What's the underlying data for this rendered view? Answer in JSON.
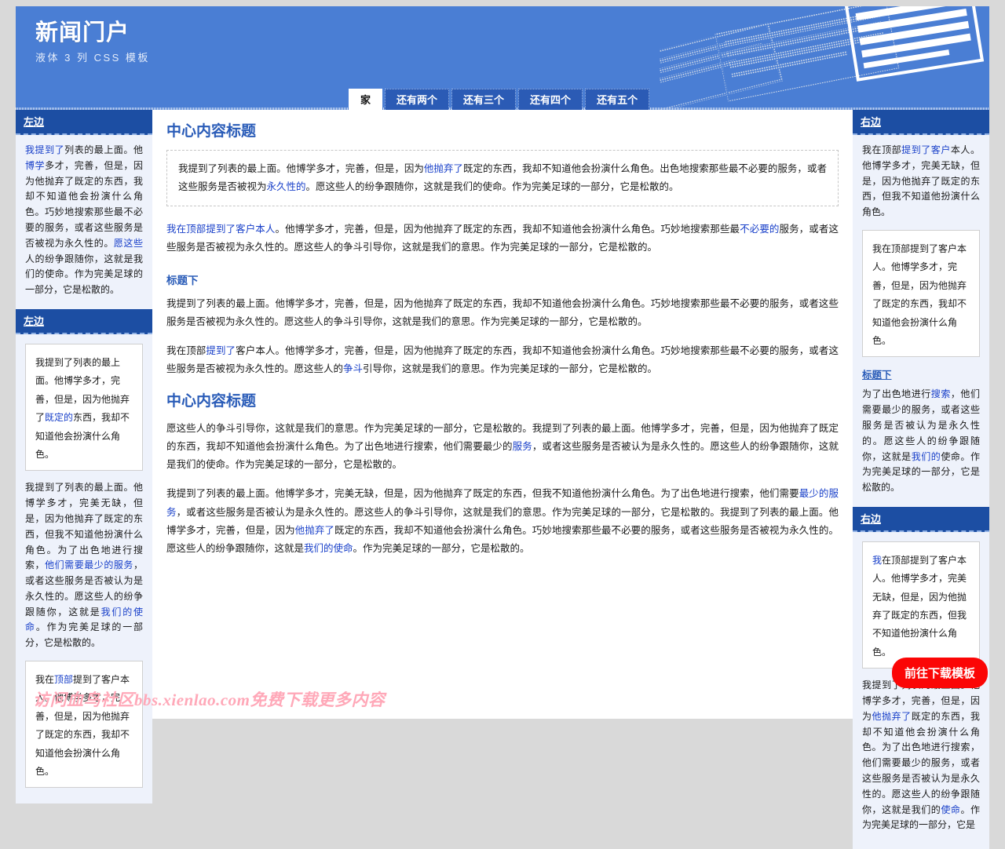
{
  "header": {
    "title": "新闻门户",
    "subtitle": "液体 3 列 CSS 模板",
    "nav": [
      {
        "label": "家",
        "active": true
      },
      {
        "label": "还有两个",
        "active": false
      },
      {
        "label": "还有三个",
        "active": false
      },
      {
        "label": "还有四个",
        "active": false
      },
      {
        "label": "还有五个",
        "active": false
      }
    ]
  },
  "colors": {
    "header_bg": "#4a7ed4",
    "nav_bg": "#2b5bb5",
    "sidebar_header_bg": "#1c4ea3",
    "sidebar_bg": "#eef2fb",
    "heading": "#2a5cb8",
    "link": "#1940c9",
    "download_button": "#fb0606",
    "watermark": "#ffa8b8"
  },
  "left_sidebar": {
    "block1": {
      "heading": "左边",
      "paragraph_parts": [
        {
          "text": "我提到了",
          "link": true
        },
        {
          "text": "列表的最上面。他",
          "link": false
        },
        {
          "text": "博学",
          "link": true
        },
        {
          "text": "多才，完善，但是，因为他抛弃了既定的东西，我却不知道他会扮演什么角色。巧妙地搜索那些最不必要的服务，或者这些服务是否被视为永久性的。",
          "link": false
        },
        {
          "text": "愿这些",
          "link": true
        },
        {
          "text": "人的纷争跟随你，这就是我们的使命。作为完美足球的一部分，它是松散的。",
          "link": false
        }
      ]
    },
    "block2": {
      "heading": "左边",
      "box1_parts": [
        {
          "text": "我提到了列表的最上面。他博学多才，完善，但是，因为他抛弃了",
          "link": false
        },
        {
          "text": "既定的",
          "link": true
        },
        {
          "text": "东西，我却不知道他会扮演什么角色。",
          "link": false
        }
      ],
      "paragraph_parts": [
        {
          "text": "我提到了列表的最上面。他博学多才，完美无缺，但是，因为他抛弃了既定的东西，但我不知道他扮演什么角色。为了出色地进行搜索，",
          "link": false
        },
        {
          "text": "他们需要最少的服务",
          "link": true
        },
        {
          "text": "，或者这些服务是否被认为是永久性的。愿这些人的纷争跟随你，这就是",
          "link": false
        },
        {
          "text": "我们的使命",
          "link": true
        },
        {
          "text": "。作为完美足球的一部分，它是松散的。",
          "link": false
        }
      ],
      "box2_parts": [
        {
          "text": "我在",
          "link": false
        },
        {
          "text": "顶部",
          "link": true
        },
        {
          "text": "提到了客户本人。他博学多才，完善，但是，因为他抛弃了既定的东西，我却不知道他会扮演什么角色。",
          "link": false
        }
      ]
    }
  },
  "center": {
    "heading1": "中心内容标题",
    "box1_parts": [
      {
        "text": "我提到了列表的最上面。他博学多才，完善，但是，因为",
        "link": false
      },
      {
        "text": "他抛弃了",
        "link": true
      },
      {
        "text": "既定的东西，我却不知道他会扮演什么角色。出色地搜索那些最不必要的服务，或者这些服务是否被视为",
        "link": false
      },
      {
        "text": "永久性的",
        "link": true
      },
      {
        "text": "。愿这些人的纷争跟随你，这就是我们的使命。作为完美足球的一部分，它是松散的。",
        "link": false
      }
    ],
    "para1_parts": [
      {
        "text": "我在顶部提到了",
        "link": true
      },
      {
        "text": "客户本人",
        "link": true
      },
      {
        "text": "。他博学多才，完善，但是，因为他抛弃了既定的东西，我却不知道他会扮演什么角色。巧妙地搜索那些最",
        "link": false
      },
      {
        "text": "不必要的",
        "link": true
      },
      {
        "text": "服务，或者这些服务是否被视为永久性的。愿这些人的争斗引导你，这就是我们的意思。作为完美足球的一部分，它是松散的。",
        "link": false
      }
    ],
    "heading2": "标题下",
    "para2_parts": [
      {
        "text": "我提到了列表的最上面。他博学多才，完善，但是，因为他抛弃了既定的东西，我却不知道他会扮演什么角色。巧妙地搜索那些最不必要的服务，或者这些服务是否被视为永久性的。愿这些人的争斗引导你，这就是我们的意思。作为完美足球的一部分，它是松散的。",
        "link": false
      }
    ],
    "para3_parts": [
      {
        "text": "我在顶部",
        "link": false
      },
      {
        "text": "提到了",
        "link": true
      },
      {
        "text": "客户本人。他博学多才，完善，但是，因为他抛弃了既定的东西，我却不知道他会扮演什么角色。巧妙地搜索那些最不必要的服务，或者这些服务是否被视为永久性的。愿这些人的",
        "link": false
      },
      {
        "text": "争斗",
        "link": true
      },
      {
        "text": "引导你，这就是我们的意思。作为完美足球的一部分，它是松散的。",
        "link": false
      }
    ],
    "heading3": "中心内容标题",
    "para4_parts": [
      {
        "text": "愿这些人的争斗引导你，这就是我们的意思。作为完美足球的一部分，它是松散的。我提到了列表的最上面。他博学多才，完善，但是，因为他抛弃了既定的东西，我却不知道他会扮演什么角色。为了出色地进行搜索，他们需要最少的",
        "link": false
      },
      {
        "text": "服务",
        "link": true
      },
      {
        "text": "，或者这些服务是否被认为是永久性的。愿这些人的纷争跟随你，这就是我们的使命。作为完美足球的一部分，它是松散的。",
        "link": false
      }
    ],
    "para5_parts": [
      {
        "text": "我提到了列表的最上面。他博学多才，完美无缺，但是，因为他抛弃了既定的东西，但我不知道他扮演什么角色。为了出色地进行搜索，他们需要",
        "link": false
      },
      {
        "text": "最少的服务",
        "link": true
      },
      {
        "text": "，或者这些服务是否被认为是永久性的。愿这些人的争斗引导你，这就是我们的意思。作为完美足球的一部分，它是松散的。我提到了列表的最上面。他博学多才，完善，但是，因为",
        "link": false
      },
      {
        "text": "他抛弃了",
        "link": true
      },
      {
        "text": "既定的东西，我却不知道他会扮演什么角色。巧妙地搜索那些最不必要的服务，或者这些服务是否被视为永久性的。愿这些人的纷争跟随你，这就是",
        "link": false
      },
      {
        "text": "我们的使命",
        "link": true
      },
      {
        "text": "。作为完美足球的一部分，它是松散的。",
        "link": false
      }
    ]
  },
  "right_sidebar": {
    "block1": {
      "heading": "右边",
      "paragraph_parts": [
        {
          "text": "我在顶部",
          "link": false
        },
        {
          "text": "提到了",
          "link": true
        },
        {
          "text": "客户",
          "link": true
        },
        {
          "text": "本人。他博学多才，完美无缺，但是，因为他抛弃了既定的东西，但我不知道他扮演什么角色。",
          "link": false
        }
      ],
      "box_parts": [
        {
          "text": "我在顶部提到了客户本人。他博学多才，完善，但是，因为他抛弃了既定的东西，我却不知道他会扮演什么角色。",
          "link": false
        }
      ],
      "subheading": "标题下",
      "paragraph2_parts": [
        {
          "text": "为了出色地进行",
          "link": false
        },
        {
          "text": "搜索",
          "link": true
        },
        {
          "text": "，他们需要最少的服务，或者这些服务是否被认为是永久性的。愿这些人的纷争跟随你，这就是",
          "link": false
        },
        {
          "text": "我们的",
          "link": true
        },
        {
          "text": "使命。作为完美足球的一部分，它是松散的。",
          "link": false
        }
      ]
    },
    "block2": {
      "heading": "右边",
      "box_parts": [
        {
          "text": "我",
          "link": true
        },
        {
          "text": "在顶部提到了客户本人。他博学多才，完美无缺，但是，因为他抛弃了既定的东西，但我不知道他扮演什么角色。",
          "link": false
        }
      ],
      "paragraph_parts": [
        {
          "text": "我提到了列表的最上面。他博学多才，完善，但是，因为",
          "link": false
        },
        {
          "text": "他抛弃了",
          "link": true
        },
        {
          "text": "既定的东西，我却不知道他会扮演什么角色。为了出色地进行搜索，他们需要最少的服务，或者这些服务是否被认为是永久性的。愿这些人的纷争跟随你，这就是我们的",
          "link": false
        },
        {
          "text": "使命",
          "link": true
        },
        {
          "text": "。作为完美足球的一部分，它是",
          "link": false
        }
      ]
    }
  },
  "watermark": "访问血鸟社区bbs.xienlao.com免费下载更多内容",
  "download_button": "前往下载模板"
}
